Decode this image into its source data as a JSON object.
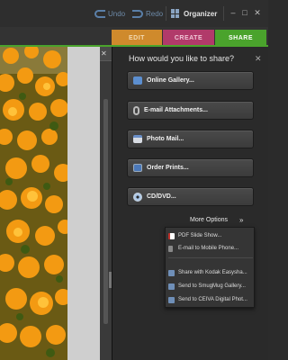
{
  "titlebar": {
    "undo_label": "Undo",
    "redo_label": "Redo",
    "organizer_label": "Organizer",
    "minimize": "–",
    "maximize": "□",
    "close": "✕"
  },
  "tabs": [
    {
      "label": "EDIT"
    },
    {
      "label": "CREATE"
    },
    {
      "label": "SHARE"
    }
  ],
  "photo_header": {
    "minimize": "–",
    "restore": "▫",
    "close": "✕"
  },
  "share": {
    "question": "How would you like to share?",
    "close": "✕",
    "buttons": [
      {
        "label": "Online Gallery...",
        "icon": "online-gallery-icon"
      },
      {
        "label": "E-mail Attachments...",
        "icon": "paperclip-icon"
      },
      {
        "label": "Photo Mail...",
        "icon": "photo-mail-icon"
      },
      {
        "label": "Order Prints...",
        "icon": "order-prints-icon"
      },
      {
        "label": "CD/DVD...",
        "icon": "disc-icon"
      }
    ],
    "more_options": "More Options",
    "more_chevron": "»"
  },
  "menu": {
    "items": [
      {
        "label": "PDF Slide Show...",
        "icon": "pdf-icon"
      },
      {
        "label": "E-mail to Mobile Phone...",
        "icon": "mobile-phone-icon"
      },
      {
        "label": "Share with Kodak Easysha...",
        "icon": "share-service-icon"
      },
      {
        "label": "Send to SmugMug Gallery...",
        "icon": "share-service-icon"
      },
      {
        "label": "Send to CEIVA Digital Phot...",
        "icon": "share-service-icon"
      }
    ]
  },
  "colors": {
    "edit_tab": "#cf8a2c",
    "create_tab": "#b13a6a",
    "share_tab": "#4aa32c"
  }
}
